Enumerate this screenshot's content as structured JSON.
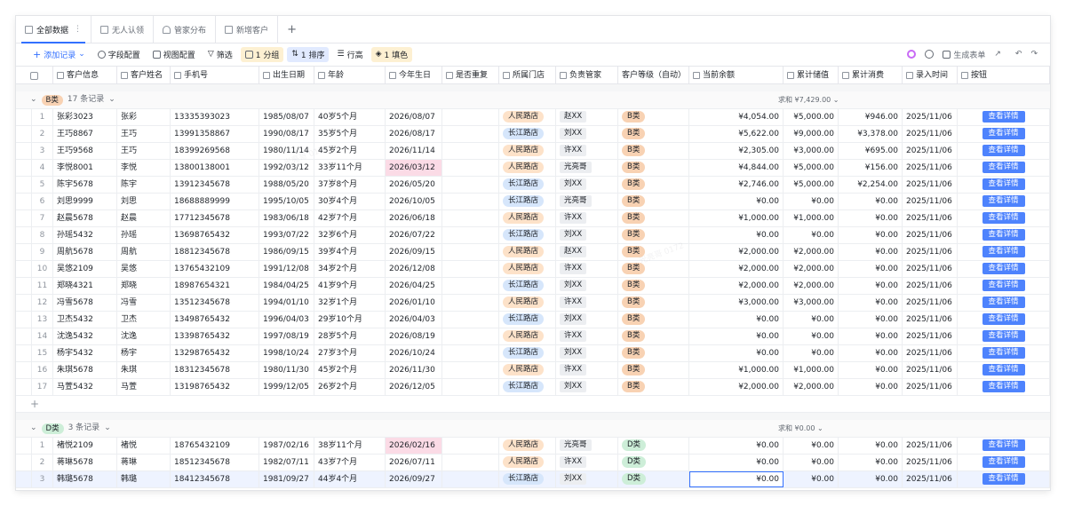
{
  "tabs": [
    {
      "label": "全部数据",
      "active": true,
      "icon": "table-icon"
    },
    {
      "label": "无人认领",
      "active": false,
      "icon": "table-icon"
    },
    {
      "label": "管家分布",
      "active": false,
      "icon": "chart-icon"
    },
    {
      "label": "新增客户",
      "active": false,
      "icon": "form-icon"
    }
  ],
  "toolbar": {
    "add_record": "添加记录",
    "field_config": "字段配置",
    "view_config": "视图配置",
    "filter": "筛选",
    "group": "1 分组",
    "sort": "1 排序",
    "row_height": "行高",
    "fill": "1 填色",
    "generate_form": "生成表单"
  },
  "columns": [
    {
      "key": "name_id",
      "label": "客户信息",
      "icon": "lock-icon"
    },
    {
      "key": "name",
      "label": "客户姓名",
      "icon": "text-icon"
    },
    {
      "key": "phone",
      "label": "手机号",
      "icon": "phone-icon"
    },
    {
      "key": "birth",
      "label": "出生日期",
      "icon": "date-icon"
    },
    {
      "key": "age",
      "label": "年龄",
      "icon": "formula-icon"
    },
    {
      "key": "bday",
      "label": "今年生日",
      "icon": "formula-icon"
    },
    {
      "key": "dup",
      "label": "是否重复",
      "icon": "formula-icon"
    },
    {
      "key": "store",
      "label": "所属门店",
      "icon": "select-icon"
    },
    {
      "key": "mgr",
      "label": "负责管家",
      "icon": "link-icon"
    },
    {
      "key": "level",
      "label": "客户等级（自动）",
      "icon": ""
    },
    {
      "key": "balance",
      "label": "当前余额",
      "icon": "formula-icon"
    },
    {
      "key": "stored",
      "label": "累计储值",
      "icon": "lookup-icon"
    },
    {
      "key": "spent",
      "label": "累计消费",
      "icon": "lookup-icon"
    },
    {
      "key": "entry",
      "label": "录入时间",
      "icon": "created-time-icon"
    },
    {
      "key": "btn",
      "label": "按钮",
      "icon": "button-icon"
    }
  ],
  "groups": [
    {
      "tag": "B类",
      "count": "17 条记录",
      "sum": "求和 ¥7,429.00",
      "rows": [
        {
          "i": "1",
          "name_id": "张彩3023",
          "name": "张彩",
          "phone": "13335393023",
          "birth": "1985/08/07",
          "age": "40岁5个月",
          "bday": "2026/08/07",
          "store": "人民路店",
          "mgr": "赵XX",
          "level": "B类",
          "balance": "¥4,054.00",
          "stored": "¥5,000.00",
          "spent": "¥946.00",
          "entry": "2025/11/06",
          "btn": "查看详情"
        },
        {
          "i": "2",
          "name_id": "王巧8867",
          "name": "王巧",
          "phone": "13991358867",
          "birth": "1990/08/17",
          "age": "35岁5个月",
          "bday": "2026/08/17",
          "store": "长江路店",
          "mgr": "刘XX",
          "level": "B类",
          "balance": "¥5,622.00",
          "stored": "¥9,000.00",
          "spent": "¥3,378.00",
          "entry": "2025/11/06",
          "btn": "查看详情"
        },
        {
          "i": "3",
          "name_id": "王巧9568",
          "name": "王巧",
          "phone": "18399269568",
          "birth": "1980/11/14",
          "age": "45岁2个月",
          "bday": "2026/11/14",
          "store": "人民路店",
          "mgr": "许XX",
          "level": "B类",
          "balance": "¥2,305.00",
          "stored": "¥3,000.00",
          "spent": "¥695.00",
          "entry": "2025/11/06",
          "btn": "查看详情"
        },
        {
          "i": "4",
          "name_id": "李悦8001",
          "name": "李悦",
          "phone": "13800138001",
          "birth": "1992/03/12",
          "age": "33岁11个月",
          "bday": "2026/03/12",
          "store": "人民路店",
          "mgr": "光亮哥",
          "level": "B类",
          "balance": "¥4,844.00",
          "stored": "¥5,000.00",
          "spent": "¥156.00",
          "entry": "2025/11/06",
          "btn": "查看详情",
          "pink": true
        },
        {
          "i": "5",
          "name_id": "陈宇5678",
          "name": "陈宇",
          "phone": "13912345678",
          "birth": "1988/05/20",
          "age": "37岁8个月",
          "bday": "2026/05/20",
          "store": "长江路店",
          "mgr": "刘XX",
          "level": "B类",
          "balance": "¥2,746.00",
          "stored": "¥5,000.00",
          "spent": "¥2,254.00",
          "entry": "2025/11/06",
          "btn": "查看详情"
        },
        {
          "i": "6",
          "name_id": "刘思9999",
          "name": "刘思",
          "phone": "18688889999",
          "birth": "1995/10/05",
          "age": "30岁4个月",
          "bday": "2026/10/05",
          "store": "长江路店",
          "mgr": "光亮哥",
          "level": "B类",
          "balance": "¥0.00",
          "stored": "¥0.00",
          "spent": "¥0.00",
          "entry": "2025/11/06",
          "btn": "查看详情"
        },
        {
          "i": "7",
          "name_id": "赵晨5678",
          "name": "赵晨",
          "phone": "17712345678",
          "birth": "1983/06/18",
          "age": "42岁7个月",
          "bday": "2026/06/18",
          "store": "人民路店",
          "mgr": "许XX",
          "level": "B类",
          "balance": "¥1,000.00",
          "stored": "¥1,000.00",
          "spent": "¥0.00",
          "entry": "2025/11/06",
          "btn": "查看详情"
        },
        {
          "i": "8",
          "name_id": "孙瑶5432",
          "name": "孙瑶",
          "phone": "13698765432",
          "birth": "1993/07/22",
          "age": "32岁6个月",
          "bday": "2026/07/22",
          "store": "长江路店",
          "mgr": "刘XX",
          "level": "B类",
          "balance": "¥0.00",
          "stored": "¥0.00",
          "spent": "¥0.00",
          "entry": "2025/11/06",
          "btn": "查看详情"
        },
        {
          "i": "9",
          "name_id": "周航5678",
          "name": "周航",
          "phone": "18812345678",
          "birth": "1986/09/15",
          "age": "39岁4个月",
          "bday": "2026/09/15",
          "store": "人民路店",
          "mgr": "赵XX",
          "level": "B类",
          "balance": "¥2,000.00",
          "stored": "¥2,000.00",
          "spent": "¥0.00",
          "entry": "2025/11/06",
          "btn": "查看详情"
        },
        {
          "i": "10",
          "name_id": "吴悠2109",
          "name": "吴悠",
          "phone": "13765432109",
          "birth": "1991/12/08",
          "age": "34岁2个月",
          "bday": "2026/12/08",
          "store": "人民路店",
          "mgr": "许XX",
          "level": "B类",
          "balance": "¥2,000.00",
          "stored": "¥2,000.00",
          "spent": "¥0.00",
          "entry": "2025/11/06",
          "btn": "查看详情"
        },
        {
          "i": "11",
          "name_id": "郑晓4321",
          "name": "郑晓",
          "phone": "18987654321",
          "birth": "1984/04/25",
          "age": "41岁9个月",
          "bday": "2026/04/25",
          "store": "长江路店",
          "mgr": "刘XX",
          "level": "B类",
          "balance": "¥2,000.00",
          "stored": "¥2,000.00",
          "spent": "¥0.00",
          "entry": "2025/11/06",
          "btn": "查看详情"
        },
        {
          "i": "12",
          "name_id": "冯雪5678",
          "name": "冯雪",
          "phone": "13512345678",
          "birth": "1994/01/10",
          "age": "32岁1个月",
          "bday": "2026/01/10",
          "store": "人民路店",
          "mgr": "许XX",
          "level": "B类",
          "balance": "¥3,000.00",
          "stored": "¥3,000.00",
          "spent": "¥0.00",
          "entry": "2025/11/06",
          "btn": "查看详情"
        },
        {
          "i": "13",
          "name_id": "卫杰5432",
          "name": "卫杰",
          "phone": "13498765432",
          "birth": "1996/04/03",
          "age": "29岁10个月",
          "bday": "2026/04/03",
          "store": "长江路店",
          "mgr": "刘XX",
          "level": "B类",
          "balance": "¥0.00",
          "stored": "¥0.00",
          "spent": "¥0.00",
          "entry": "2025/11/06",
          "btn": "查看详情"
        },
        {
          "i": "14",
          "name_id": "沈逸5432",
          "name": "沈逸",
          "phone": "13398765432",
          "birth": "1997/08/19",
          "age": "28岁5个月",
          "bday": "2026/08/19",
          "store": "人民路店",
          "mgr": "许XX",
          "level": "B类",
          "balance": "¥0.00",
          "stored": "¥0.00",
          "spent": "¥0.00",
          "entry": "2025/11/06",
          "btn": "查看详情"
        },
        {
          "i": "15",
          "name_id": "杨宇5432",
          "name": "杨宇",
          "phone": "13298765432",
          "birth": "1998/10/24",
          "age": "27岁3个月",
          "bday": "2026/10/24",
          "store": "长江路店",
          "mgr": "刘XX",
          "level": "B类",
          "balance": "¥0.00",
          "stored": "¥0.00",
          "spent": "¥0.00",
          "entry": "2025/11/06",
          "btn": "查看详情"
        },
        {
          "i": "16",
          "name_id": "朱琪5678",
          "name": "朱琪",
          "phone": "18312345678",
          "birth": "1980/11/30",
          "age": "45岁2个月",
          "bday": "2026/11/30",
          "store": "人民路店",
          "mgr": "许XX",
          "level": "B类",
          "balance": "¥1,000.00",
          "stored": "¥1,000.00",
          "spent": "¥0.00",
          "entry": "2025/11/06",
          "btn": "查看详情"
        },
        {
          "i": "17",
          "name_id": "马萱5432",
          "name": "马萱",
          "phone": "13198765432",
          "birth": "1999/12/05",
          "age": "26岁2个月",
          "bday": "2026/12/05",
          "store": "长江路店",
          "mgr": "刘XX",
          "level": "B类",
          "balance": "¥2,000.00",
          "stored": "¥2,000.00",
          "spent": "¥0.00",
          "entry": "2025/11/06",
          "btn": "查看详情"
        }
      ]
    },
    {
      "tag": "D类",
      "count": "3 条记录",
      "sum": "求和 ¥0.00",
      "rows": [
        {
          "i": "1",
          "name_id": "褚悦2109",
          "name": "褚悦",
          "phone": "18765432109",
          "birth": "1987/02/16",
          "age": "38岁11个月",
          "bday": "2026/02/16",
          "store": "人民路店",
          "mgr": "光亮哥",
          "level": "D类",
          "balance": "¥0.00",
          "stored": "¥0.00",
          "spent": "¥0.00",
          "entry": "2025/11/06",
          "btn": "查看详情",
          "pink": true
        },
        {
          "i": "2",
          "name_id": "蒋琳5678",
          "name": "蒋琳",
          "phone": "18512345678",
          "birth": "1982/07/11",
          "age": "43岁7个月",
          "bday": "2026/07/11",
          "store": "人民路店",
          "mgr": "许XX",
          "level": "D类",
          "balance": "¥0.00",
          "stored": "¥0.00",
          "spent": "¥0.00",
          "entry": "2025/11/06",
          "btn": "查看详情"
        },
        {
          "i": "3",
          "name_id": "韩璐5678",
          "name": "韩璐",
          "phone": "18412345678",
          "birth": "1981/09/27",
          "age": "44岁4个月",
          "bday": "2026/09/27",
          "store": "长江路店",
          "mgr": "刘XX",
          "level": "D类",
          "balance": "¥0.00",
          "stored": "¥0.00",
          "spent": "¥0.00",
          "entry": "2025/11/06",
          "btn": "查看详情",
          "selected": true
        }
      ]
    }
  ],
  "colors": {
    "accent": "#3370ff",
    "button": "#4e83fd",
    "pink": "#fbdbe6",
    "b_tag": "#f8d2b3",
    "d_tag": "#cdeed8"
  }
}
